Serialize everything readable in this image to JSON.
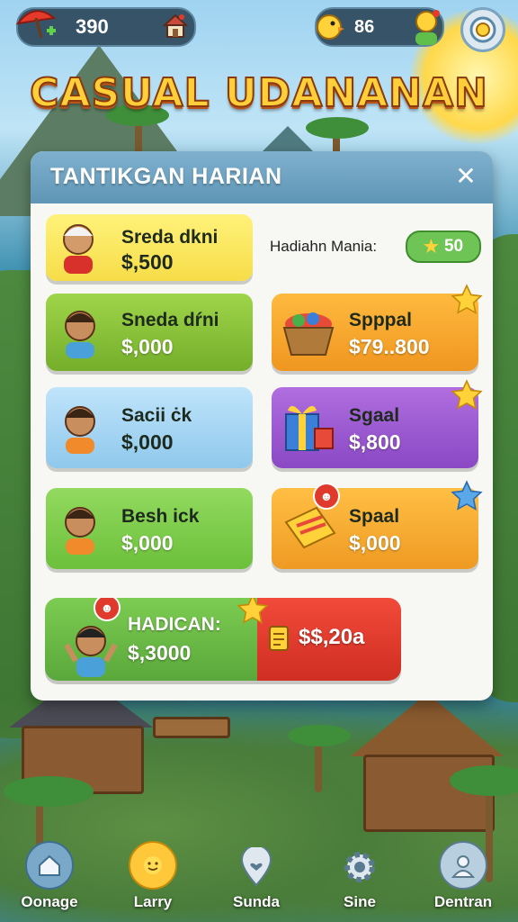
{
  "top_bar": {
    "coins": "390",
    "energy": "86",
    "icons": {
      "coins": "umbrella-icon",
      "home": "house-icon",
      "energy": "chick-icon",
      "profile": "character-icon",
      "settings": "settings-icon"
    }
  },
  "title": "CASUAL UDANANAN",
  "modal": {
    "title": "TANTIKGAN HARIAN",
    "close_label": "✕",
    "bonus_label": "Hadiahn Mania:",
    "bonus_value": "50",
    "cards": [
      {
        "name": "Sreda dkni",
        "amount": "$,500",
        "color": "#fbe660"
      },
      {
        "name": "Sneda dŕni",
        "amount": "$,000",
        "color": "#8cc437"
      },
      {
        "name": "Spppal",
        "amount": "$79..800",
        "color": "#f6a52c"
      },
      {
        "name": "Sacii ċk",
        "amount": "$,000",
        "color": "#9fd2f2"
      },
      {
        "name": "Sgaal",
        "amount": "$,800",
        "color": "#9a5bd0"
      },
      {
        "name": "Besh ick",
        "amount": "$,000",
        "color": "#84cf56"
      },
      {
        "name": "Spaal",
        "amount": "$,000",
        "color": "#f6aa2e"
      }
    ],
    "claim": {
      "label": "HADICAN:",
      "amount": "$,3000",
      "price": "$$,20a"
    }
  },
  "nav": [
    {
      "label": "Oonage",
      "icon": "home-icon"
    },
    {
      "label": "Larry",
      "icon": "sun-icon"
    },
    {
      "label": "Sunda",
      "icon": "heart-pin-icon"
    },
    {
      "label": "Sine",
      "icon": "gear-icon"
    },
    {
      "label": "Dentran",
      "icon": "profile-icon"
    }
  ]
}
